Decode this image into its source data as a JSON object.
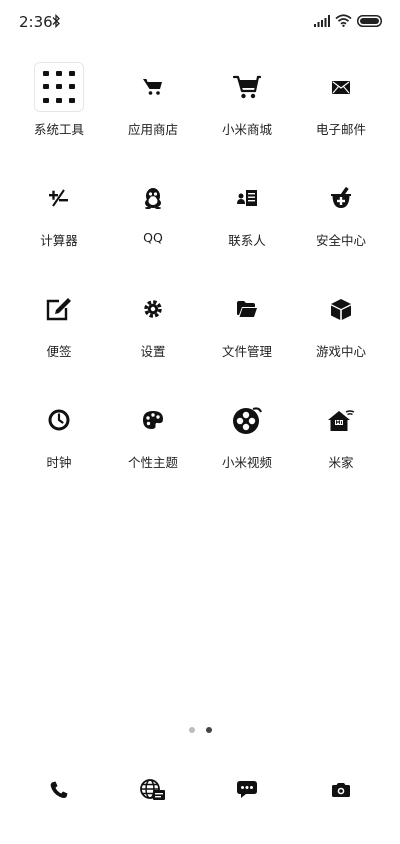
{
  "status_bar": {
    "time": "2:36",
    "icons": [
      "bluetooth-icon",
      "signal-icon",
      "wifi-icon",
      "battery-icon"
    ]
  },
  "home_grid": {
    "rows": [
      [
        {
          "label": "系统工具",
          "icon": "folder-icon"
        },
        {
          "label": "应用商店",
          "icon": "shopping-cart-icon"
        },
        {
          "label": "小米商城",
          "icon": "cart-icon"
        },
        {
          "label": "电子邮件",
          "icon": "envelope-icon"
        }
      ],
      [
        {
          "label": "计算器",
          "icon": "plus-minus-icon"
        },
        {
          "label": "QQ",
          "icon": "penguin-icon"
        },
        {
          "label": "联系人",
          "icon": "contacts-icon"
        },
        {
          "label": "安全中心",
          "icon": "mortar-pestle-icon"
        }
      ],
      [
        {
          "label": "便签",
          "icon": "edit-note-icon"
        },
        {
          "label": "设置",
          "icon": "gear-icon"
        },
        {
          "label": "文件管理",
          "icon": "folder-open-icon"
        },
        {
          "label": "游戏中心",
          "icon": "cube-icon"
        }
      ],
      [
        {
          "label": "时钟",
          "icon": "clock-icon"
        },
        {
          "label": "个性主题",
          "icon": "palette-icon"
        },
        {
          "label": "小米视频",
          "icon": "film-reel-icon"
        },
        {
          "label": "米家",
          "icon": "smart-home-icon"
        }
      ]
    ]
  },
  "pager": {
    "page_count": 2,
    "active_page": 2
  },
  "dock": [
    {
      "icon": "phone-icon"
    },
    {
      "icon": "globe-browser-icon"
    },
    {
      "icon": "message-icon"
    },
    {
      "icon": "camera-icon"
    }
  ]
}
